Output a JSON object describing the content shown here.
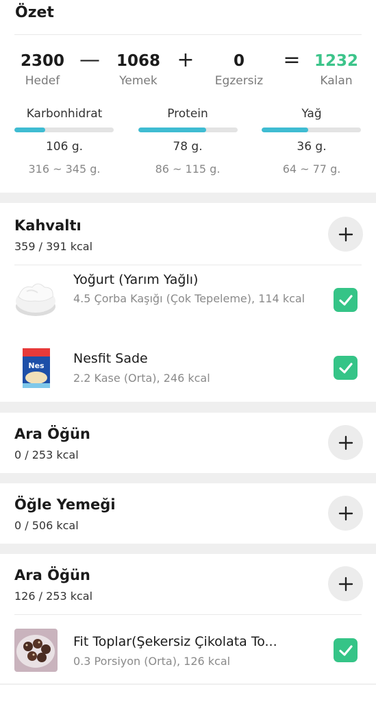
{
  "summary": {
    "title": "Özet",
    "goal": {
      "value": "2300",
      "label": "Hedef"
    },
    "minus": "—",
    "food": {
      "value": "1068",
      "label": "Yemek"
    },
    "plus": "+",
    "exercise": {
      "value": "0",
      "label": "Egzersiz"
    },
    "equals": "=",
    "remaining": {
      "value": "1232",
      "label": "Kalan",
      "color": "#3cc48a"
    },
    "macros": [
      {
        "name": "Karbonhidrat",
        "value": "106 g.",
        "range": "316 ~ 345 g.",
        "progress": 0.31
      },
      {
        "name": "Protein",
        "value": "78 g.",
        "range": "86 ~ 115 g.",
        "progress": 0.68
      },
      {
        "name": "Yağ",
        "value": "36 g.",
        "range": "64 ~ 77 g.",
        "progress": 0.47
      }
    ],
    "bar_color": "#3fbcd2"
  },
  "meals": [
    {
      "title": "Kahvaltı",
      "kcal": "359 / 391 kcal",
      "foods": [
        {
          "name": "Yoğurt (Yarım Yağlı)",
          "detail": "4.5 Çorba Kaşığı (Çok Tepeleme), 114 kcal",
          "checked": true,
          "icon": "yogurt-bowl"
        },
        {
          "name": "Nesfit Sade",
          "detail": "2.2 Kase (Orta), 246 kcal",
          "checked": true,
          "icon": "cereal-box"
        }
      ]
    },
    {
      "title": "Ara Öğün",
      "kcal": "0 / 253 kcal",
      "foods": []
    },
    {
      "title": "Öğle Yemeği",
      "kcal": "0 / 506 kcal",
      "foods": []
    },
    {
      "title": "Ara Öğün",
      "kcal": "126 / 253 kcal",
      "foods": [
        {
          "name": "Fit Toplar(Şekersiz Çikolata To...",
          "detail": "0.3 Porsiyon (Orta), 126 kcal",
          "checked": true,
          "icon": "chocolate-balls"
        }
      ]
    }
  ],
  "check_color": "#35c487"
}
